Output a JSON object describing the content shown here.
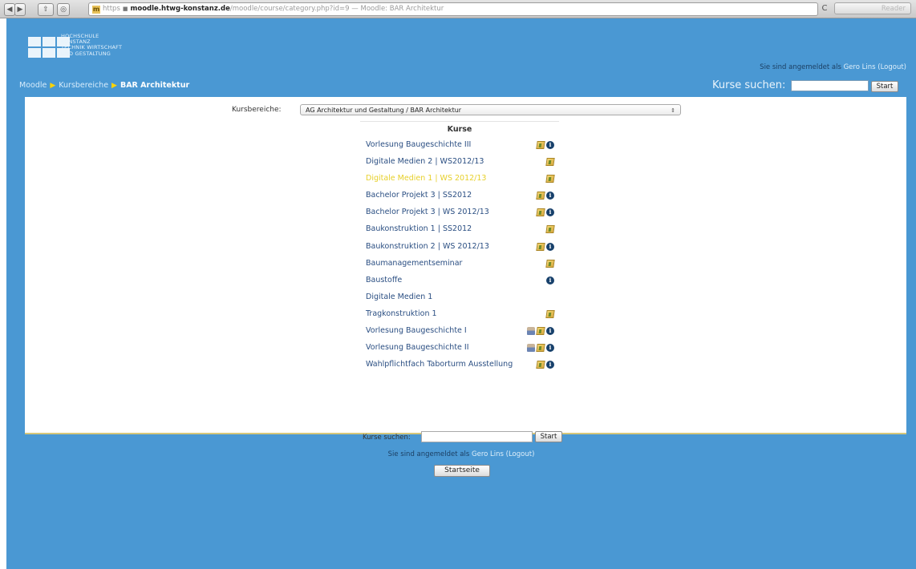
{
  "browser": {
    "back": "◀",
    "forward": "▶",
    "share": "⇧",
    "stop": "◎",
    "address_protocol": "https",
    "address_host": "moodle.htwg-konstanz.de",
    "address_path": "/moodle/course/category.php?id=9 — Moodle: BAR Architektur",
    "reload": "C",
    "reader": "Reader"
  },
  "header": {
    "logo_lines": [
      "HOCHSCHULE",
      "KONSTANZ",
      "TECHNIK WIRTSCHAFT",
      "UND GESTALTUNG"
    ],
    "login_prefix": "Sie sind angemeldet als ",
    "user_name": "Gero Lins",
    "logout_label": "(Logout)",
    "breadcrumb": {
      "home": "Moodle",
      "categories": "Kursbereiche",
      "current": "BAR Architektur"
    },
    "search_label": "Kurse suchen:",
    "search_button": "Start"
  },
  "main": {
    "category_label": "Kursbereiche:",
    "category_selected": "AG Architektur und Gestaltung / BAR Architektur",
    "courses_heading": "Kurse",
    "courses": [
      {
        "name": "Vorlesung Baugeschichte III",
        "icons": [
          "summary-icon",
          "info-icon"
        ]
      },
      {
        "name": "Digitale Medien 2 | WS2012/13",
        "icons": [
          "summary-icon"
        ]
      },
      {
        "name": "Digitale Medien 1 | WS 2012/13",
        "icons": [
          "summary-icon"
        ],
        "highlight": true
      },
      {
        "name": "Bachelor Projekt 3 | SS2012",
        "icons": [
          "summary-icon",
          "info-icon"
        ]
      },
      {
        "name": "Bachelor Projekt 3 | WS 2012/13",
        "icons": [
          "summary-icon",
          "info-icon"
        ]
      },
      {
        "name": "Baukonstruktion 1 | SS2012",
        "icons": [
          "summary-icon"
        ]
      },
      {
        "name": "Baukonstruktion 2 | WS 2012/13",
        "icons": [
          "summary-icon",
          "info-icon"
        ]
      },
      {
        "name": "Baumanagementseminar",
        "icons": [
          "summary-icon"
        ]
      },
      {
        "name": "Baustoffe",
        "icons": [
          "info-icon"
        ]
      },
      {
        "name": "Digitale Medien 1",
        "icons": []
      },
      {
        "name": "Tragkonstruktion 1",
        "icons": [
          "summary-icon"
        ]
      },
      {
        "name": "Vorlesung Baugeschichte I",
        "icons": [
          "guest-access-icon",
          "summary-icon",
          "info-icon"
        ]
      },
      {
        "name": "Vorlesung Baugeschichte II",
        "icons": [
          "guest-access-icon",
          "summary-icon",
          "info-icon"
        ]
      },
      {
        "name": "Wahlpflichtfach Taborturm Ausstellung",
        "icons": [
          "summary-icon",
          "info-icon"
        ]
      }
    ],
    "search_label": "Kurse suchen:",
    "search_button": "Start"
  },
  "footer": {
    "login_prefix": "Sie sind angemeldet als ",
    "user_name": "Gero Lins",
    "logout_label": "(Logout)",
    "home_button": "Startseite"
  },
  "colors": {
    "page_blue": "#4a98d3",
    "link_blue": "#2a4e82",
    "highlight_yellow": "#e7d02a",
    "breadcrumb_arrow": "#ffd400"
  }
}
